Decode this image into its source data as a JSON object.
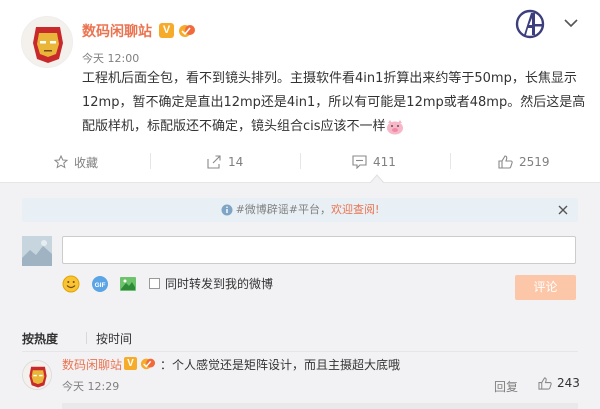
{
  "post": {
    "user_name": "数码闲聊站",
    "verified_badge": "V",
    "time": "今天 12:00",
    "text": "工程机后面全包，看不到镜头排列。主摄软件看4in1折算出来约等于50mp，长焦显示12mp，暂不确定是直出12mp还是4in1，所以有可能是12mp或者48mp。然后这是高配版样机，标配版还不确定，镜头组合cis应该不一样",
    "text_emoji": "pig-face-icon",
    "brand_icon": "avengers-logo-icon",
    "menu_icon": "chevron-down-icon"
  },
  "actions": {
    "favorite_label": "收藏",
    "repost_count": "14",
    "comment_count": "411",
    "like_count": "2519"
  },
  "notice": {
    "prefix": "#微博辟谣#平台，",
    "highlight": "欢迎查阅!"
  },
  "composer": {
    "input_value": "",
    "repost_label": "同时转发到我的微博",
    "submit_label": "评论"
  },
  "sort": {
    "hot_label": "按热度",
    "time_label": "按时间"
  },
  "comment": {
    "user_name": "数码闲聊站",
    "verified_badge": "V",
    "text": "：个人感觉还是矩阵设计，而且主摄超大底哦",
    "time": "今天 12:29",
    "reply_label": "回复",
    "like_count": "243"
  },
  "colors": {
    "brand_orange": "#eb7350",
    "panel_bg": "#f2f2f5",
    "submit_disabled": "#fcc7a8",
    "notice_bg": "#e9f0f5"
  }
}
